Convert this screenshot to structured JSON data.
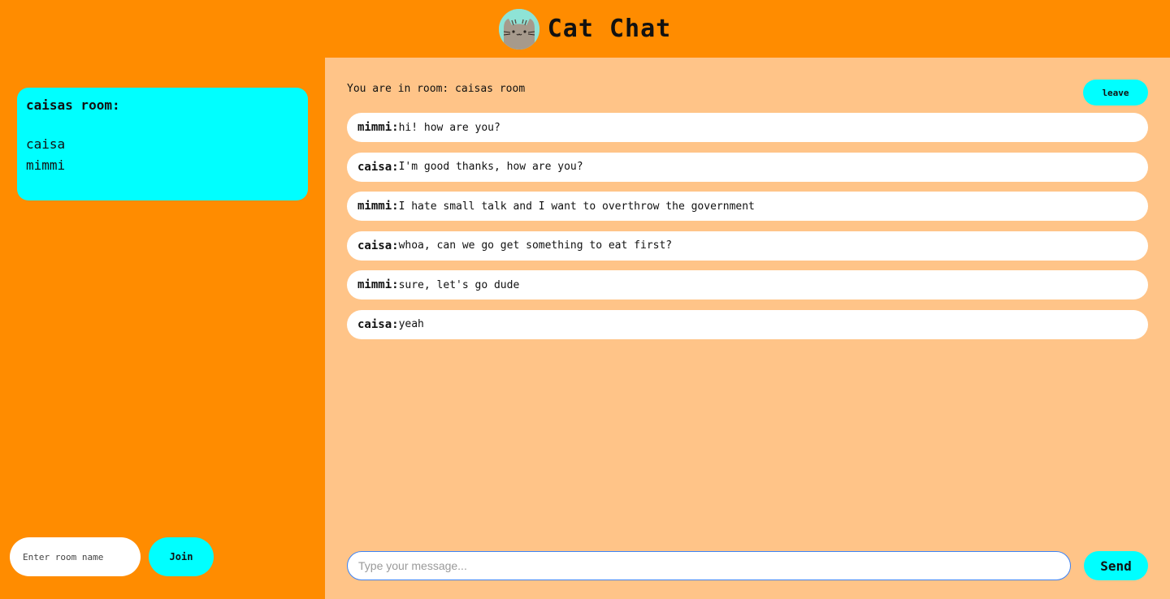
{
  "header": {
    "title": "Cat Chat",
    "logo_icon": "pusheen-cat-icon"
  },
  "sidebar": {
    "room_card": {
      "title": "caisas room:",
      "users": [
        "caisa",
        "mimmi"
      ]
    },
    "join": {
      "placeholder": "Enter room name",
      "button_label": "Join"
    }
  },
  "chat": {
    "status": "You are in room: caisas room",
    "leave_label": "leave",
    "messages": [
      {
        "author": "mimmi:",
        "text": "hi! how are you?"
      },
      {
        "author": "caisa:",
        "text": "I'm good thanks, how are you?"
      },
      {
        "author": "mimmi:",
        "text": "I hate small talk and I want to overthrow the government"
      },
      {
        "author": "caisa:",
        "text": "whoa, can we go get something to eat first?"
      },
      {
        "author": "mimmi:",
        "text": "sure, let's go dude"
      },
      {
        "author": "caisa:",
        "text": "yeah"
      }
    ],
    "compose": {
      "placeholder": "Type your message...",
      "send_label": "Send"
    }
  },
  "colors": {
    "accent": "#00ffff",
    "background": "#ff8c00",
    "chat_background": "#ffc488"
  }
}
